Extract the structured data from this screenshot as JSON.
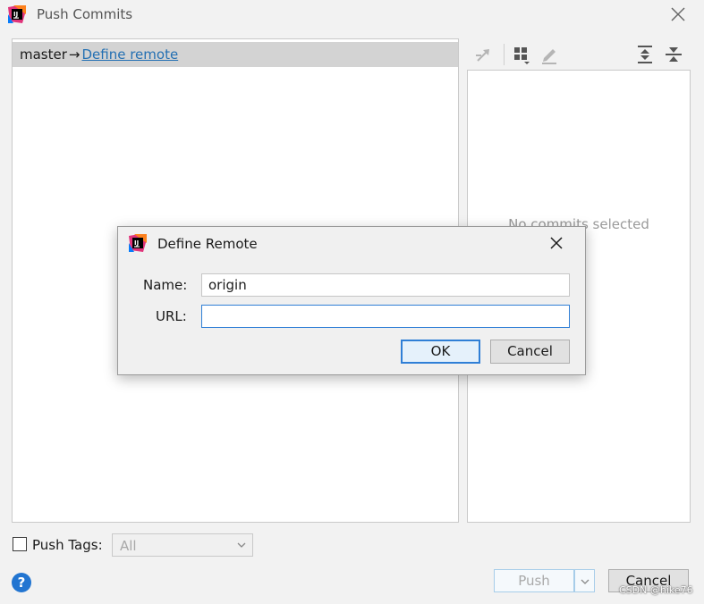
{
  "window": {
    "title": "Push Commits",
    "icon": "intellij-app-icon",
    "close_icon": "close-icon"
  },
  "commits_panel": {
    "branch": "master",
    "arrow": "→",
    "define_remote_link": "Define remote"
  },
  "details_panel": {
    "empty_text": "No commits selected",
    "toolbar_icons": [
      "cherry-pick-icon",
      "group-by-icon",
      "edit-icon",
      "expand-all-icon",
      "collapse-all-icon"
    ]
  },
  "footer": {
    "push_tags_label": "Push Tags:",
    "push_tags_checked": false,
    "tags_select_value": "All",
    "help_icon": "?",
    "push_label": "Push",
    "cancel_label": "Cancel",
    "watermark": "CSDN @hike76"
  },
  "define_remote_dialog": {
    "title": "Define Remote",
    "name_label": "Name:",
    "name_value": "origin",
    "url_label": "URL:",
    "url_value": "",
    "ok_label": "OK",
    "cancel_label": "Cancel"
  },
  "colors": {
    "accent": "#2f7fd6",
    "link": "#2470b3",
    "branch_row_bg": "#d3d3d3",
    "help_blue": "#2275d1"
  }
}
